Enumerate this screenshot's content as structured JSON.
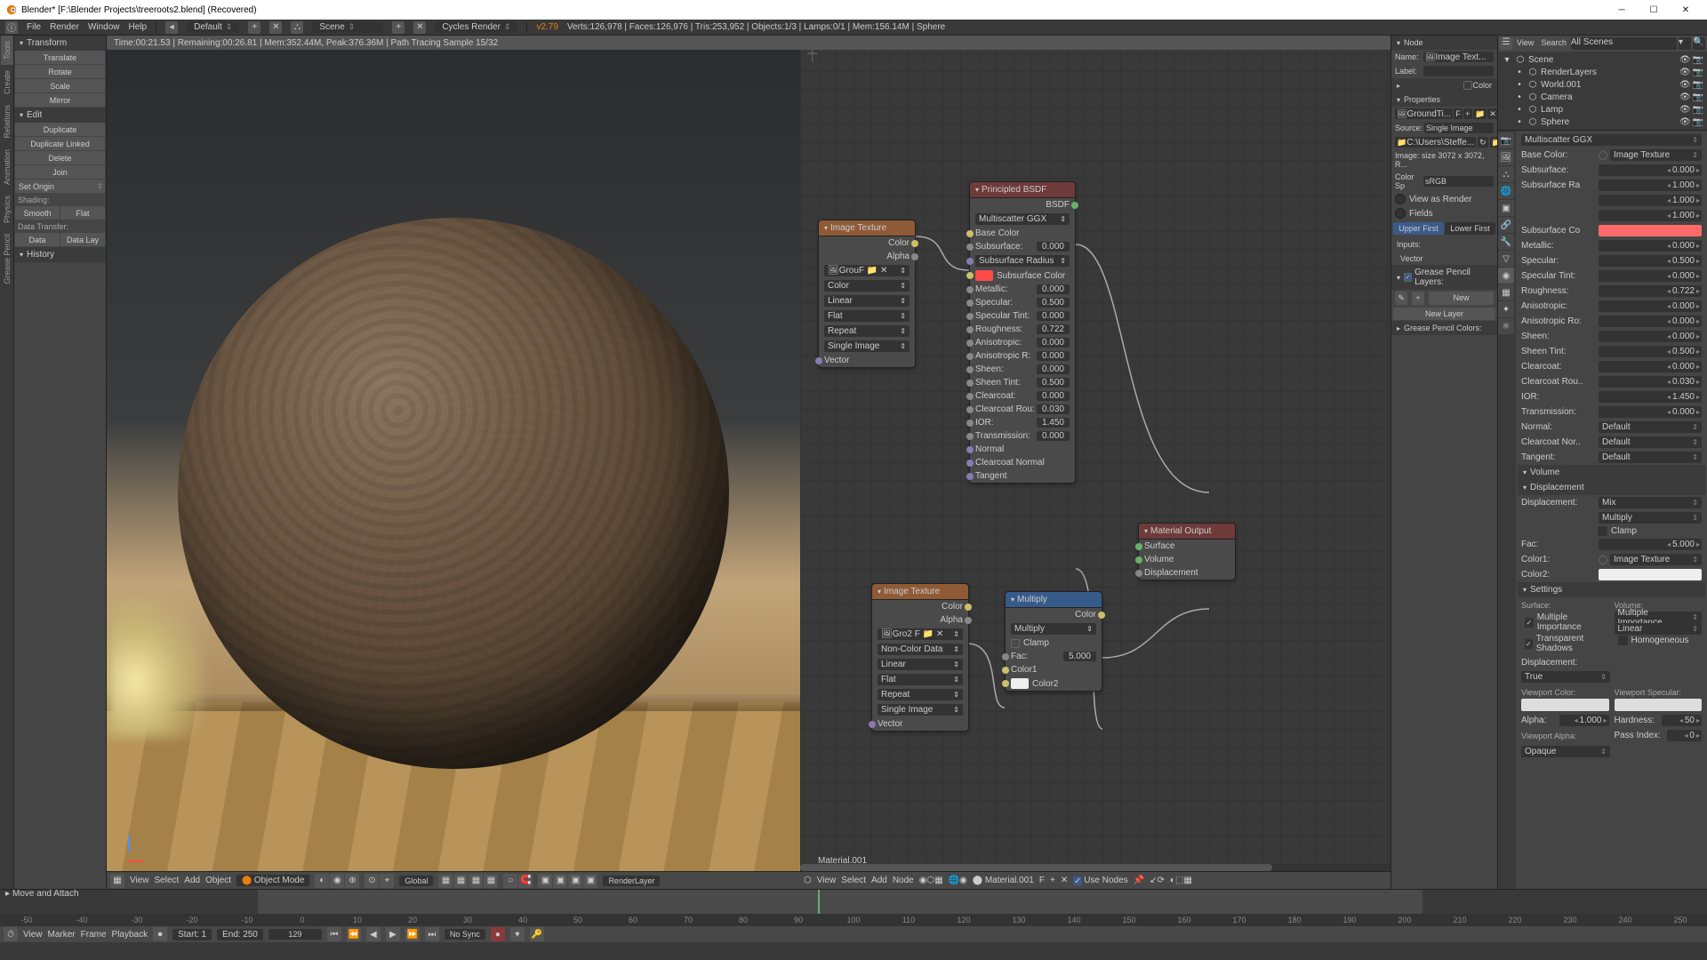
{
  "window": {
    "title": "Blender* [F:\\Blender Projects\\treeroots2.blend] (Recovered)"
  },
  "topbar": {
    "menu": [
      "File",
      "Render",
      "Window",
      "Help"
    ],
    "layout": "Default",
    "scene": "Scene",
    "engine": "Cycles Render",
    "version": "v2.79",
    "stats": "Verts:126,978 | Faces:126,976 | Tris:253,952 | Objects:1/3 | Lamps:0/1 | Mem:156.14M | Sphere"
  },
  "render_status": "Time:00:21.53 | Remaining:00:26.81 | Mem:352.44M, Peak:376.36M | Path Tracing Sample 15/32",
  "tool_tabs": [
    "Tools",
    "Create",
    "Relations",
    "Animation",
    "Physics",
    "Grease Pencil"
  ],
  "toolshelf": {
    "transform": {
      "hdr": "Transform",
      "items": [
        "Translate",
        "Rotate",
        "Scale",
        "Mirror"
      ]
    },
    "edit": {
      "hdr": "Edit",
      "items": [
        "Duplicate",
        "Duplicate Linked",
        "Delete",
        "Join"
      ],
      "set_origin": "Set Origin"
    },
    "shading": {
      "hdr": "Shading:",
      "smooth": "Smooth",
      "flat": "Flat"
    },
    "data_transfer": {
      "hdr": "Data Transfer:",
      "data": "Data",
      "data_lay": "Data Lay"
    },
    "history": "History"
  },
  "status": "Move and Attach",
  "viewport_footer": {
    "view": "View",
    "select": "Select",
    "add": "Add",
    "object": "Object",
    "mode": "Object Mode",
    "global": "Global",
    "layer": "RenderLayer"
  },
  "node_footer": {
    "view": "View",
    "select": "Select",
    "add": "Add",
    "node": "Node",
    "mat": "Material.001",
    "use_nodes": "Use Nodes"
  },
  "node_material": "Material.001",
  "nodes": {
    "imgtex": {
      "title": "Image Texture",
      "out_color": "Color",
      "out_alpha": "Alpha",
      "img": "Grou",
      "color": "Color",
      "linear": "Linear",
      "flat": "Flat",
      "repeat": "Repeat",
      "single": "Single Image",
      "vector": "Vector"
    },
    "imgtex2": {
      "title": "Image Texture",
      "out_color": "Color",
      "out_alpha": "Alpha",
      "img": "Gro",
      "noncolor": "Non-Color Data",
      "linear": "Linear",
      "flat": "Flat",
      "repeat": "Repeat",
      "single": "Single Image",
      "vector": "Vector"
    },
    "bsdf": {
      "title": "Principled BSDF",
      "out": "BSDF",
      "dist": "Multiscatter GGX",
      "base": "Base Color",
      "subsurf": "Subsurface:",
      "subsurf_v": "0.000",
      "subsurf_radius": "Subsurface Radius",
      "subsurf_color": "Subsurface Color",
      "metallic": "Metallic:",
      "metallic_v": "0.000",
      "specular": "Specular:",
      "specular_v": "0.500",
      "spectint": "Specular Tint:",
      "spectint_v": "0.000",
      "rough": "Roughness:",
      "rough_v": "0.722",
      "aniso": "Anisotropic:",
      "aniso_v": "0.000",
      "anisor": "Anisotropic R:",
      "anisor_v": "0.000",
      "sheen": "Sheen:",
      "sheen_v": "0.000",
      "sheent": "Sheen Tint:",
      "sheent_v": "0.500",
      "clear": "Clearcoat:",
      "clear_v": "0.000",
      "clearr": "Clearcoat Rou:",
      "clearr_v": "0.030",
      "ior": "IOR:",
      "ior_v": "1.450",
      "trans": "Transmission:",
      "trans_v": "0.000",
      "normal": "Normal",
      "cnormal": "Clearcoat Normal",
      "tangent": "Tangent"
    },
    "mult": {
      "title": "Multiply",
      "out": "Color",
      "op": "Multiply",
      "clamp": "Clamp",
      "fac": "Fac:",
      "fac_v": "5.000",
      "c1": "Color1",
      "c2": "Color2"
    },
    "matout": {
      "title": "Material Output",
      "surface": "Surface",
      "volume": "Volume",
      "disp": "Displacement"
    }
  },
  "sidebarN": {
    "node": "Node",
    "name_l": "Name:",
    "name_v": "Image Text...",
    "label_l": "Label:",
    "color": "Color",
    "properties": "Properties",
    "source": "Source:",
    "source_v": "Single Image",
    "imgfile": "GroundTi...",
    "pathfile": "C:\\Users\\Steffe...",
    "imgsize": "Image: size 3072 x 3072, R...",
    "colsp": "Color Sp",
    "colsp_v": "sRGB",
    "view_render": "View as Render",
    "fields": "Fields",
    "upper": "Upper First",
    "lower": "Lower First",
    "inputs": "Inputs:",
    "vector": "Vector",
    "gp_layers": "Grease Pencil Layers:",
    "new": "New",
    "new_layer": "New Layer",
    "gp_colors": "Grease Pencil Colors:"
  },
  "outliner": {
    "view": "View",
    "search": "Search",
    "scenes": "All Scenes",
    "items": [
      {
        "l": "Scene",
        "d": 0
      },
      {
        "l": "RenderLayers",
        "d": 1
      },
      {
        "l": "World.001",
        "d": 1
      },
      {
        "l": "Camera",
        "d": 1
      },
      {
        "l": "Lamp",
        "d": 1
      },
      {
        "l": "Sphere",
        "d": 1
      }
    ]
  },
  "props": {
    "dist": "Multiscatter GGX",
    "rows": [
      {
        "l": "Base Color:",
        "t": "link",
        "v": "Image Texture"
      },
      {
        "l": "Subsurface:",
        "t": "num",
        "v": "0.000"
      },
      {
        "l": "Subsurface Ra",
        "t": "num",
        "v": "1.000"
      },
      {
        "l": "",
        "t": "num",
        "v": "1.000"
      },
      {
        "l": "",
        "t": "num",
        "v": "1.000"
      },
      {
        "l": "Subsurface Co",
        "t": "swatch",
        "c": "#ff6b6b"
      },
      {
        "l": "Metallic:",
        "t": "num",
        "v": "0.000"
      },
      {
        "l": "Specular:",
        "t": "num",
        "v": "0.500"
      },
      {
        "l": "Specular Tint:",
        "t": "num",
        "v": "0.000"
      },
      {
        "l": "Roughness:",
        "t": "num",
        "v": "0.722"
      },
      {
        "l": "Anisotropic:",
        "t": "num",
        "v": "0.000"
      },
      {
        "l": "Anisotropic Ro:",
        "t": "num",
        "v": "0.000"
      },
      {
        "l": "Sheen:",
        "t": "num",
        "v": "0.000"
      },
      {
        "l": "Sheen Tint:",
        "t": "num",
        "v": "0.500"
      },
      {
        "l": "Clearcoat:",
        "t": "num",
        "v": "0.000"
      },
      {
        "l": "Clearcoat Rou..",
        "t": "num",
        "v": "0.030"
      },
      {
        "l": "IOR:",
        "t": "num",
        "v": "1.450"
      },
      {
        "l": "Transmission:",
        "t": "num",
        "v": "0.000"
      },
      {
        "l": "Normal:",
        "t": "dd",
        "v": "Default"
      },
      {
        "l": "Clearcoat Nor..",
        "t": "dd",
        "v": "Default"
      },
      {
        "l": "Tangent:",
        "t": "dd",
        "v": "Default"
      }
    ],
    "volume": "Volume",
    "displacement": "Displacement",
    "disp_l": "Displacement:",
    "disp_v": "Mix",
    "disp_op": "Multiply",
    "clamp": "Clamp",
    "fac": "Fac:",
    "fac_v": "5.000",
    "c1": "Color1:",
    "c1v": "Image Texture",
    "c2": "Color2:",
    "settings": "Settings",
    "surface_h": "Surface:",
    "volume_h": "Volume:",
    "mi": "Multiple Importance",
    "mi2": "Multiple Importance",
    "ts": "Transparent Shadows",
    "lin": "Linear",
    "homo": "Homogeneous",
    "disp2": "Displacement:",
    "disp2v": "True",
    "vc": "Viewport Color:",
    "vs": "Viewport Specular:",
    "alpha": "Alpha:",
    "alpha_v": "1.000",
    "hard": "Hardness:",
    "hard_v": "50",
    "va": "Viewport Alpha:",
    "pi": "Pass Index:",
    "pi_v": "0",
    "opaque": "Opaque"
  },
  "timeline": {
    "view": "View",
    "marker": "Marker",
    "frame": "Frame",
    "playback": "Playback",
    "start": "Start:",
    "start_v": "1",
    "end": "End:",
    "end_v": "250",
    "cur": "129",
    "nosync": "No Sync",
    "ticks": [
      -50,
      -40,
      -30,
      -20,
      -10,
      0,
      10,
      20,
      30,
      40,
      50,
      60,
      70,
      80,
      90,
      100,
      110,
      120,
      130,
      140,
      150,
      160,
      170,
      180,
      190,
      200,
      210,
      220,
      230,
      240,
      250
    ]
  }
}
